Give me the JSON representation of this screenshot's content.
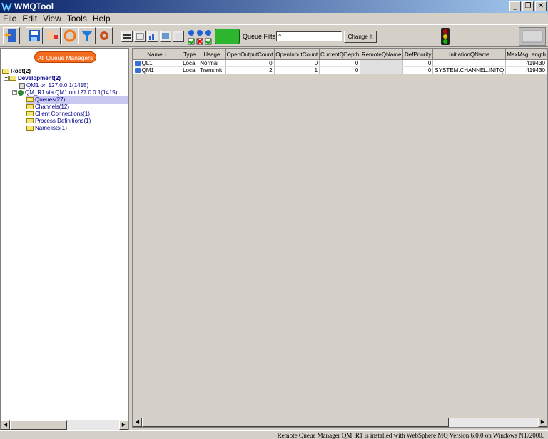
{
  "window": {
    "title": "WMQTool",
    "minimize": "_",
    "restore": "❐",
    "close": "✕"
  },
  "menu": [
    "File",
    "Edit",
    "View",
    "Tools",
    "Help"
  ],
  "toolbar": {
    "filter_label": "Queue Filter:",
    "filter_value": "*",
    "change_button": "Change It",
    "colors": {
      "traffic_red": "#cc0000",
      "traffic_yellow": "#e0c000",
      "traffic_green": "#00c000",
      "green_button": "#2db52d"
    }
  },
  "left": {
    "all_qm_button": "All Queue Managers",
    "tree": [
      {
        "label": "Root(2)",
        "bold": true
      },
      {
        "label": "Development(2)",
        "bold": true,
        "expander": "⊟"
      },
      {
        "label": "QM1 on 127.0.0.1(1415)"
      },
      {
        "label": "QM_R1 via QM1 on 127.0.0.1(1415)",
        "expander": "⊟"
      },
      {
        "label": "Queues(27)",
        "selected": true
      },
      {
        "label": "Channels(12)"
      },
      {
        "label": "Client Connections(1)"
      },
      {
        "label": "Process Definitions(1)"
      },
      {
        "label": "Namelists(1)"
      }
    ]
  },
  "table": {
    "columns": [
      "Name",
      "Type",
      "Usage",
      "OpenOutputCount",
      "OpenInputCount",
      "CurrentQDepth",
      "RemoteQName",
      "DefPriority",
      "InitiationQName",
      "MaxMsgLength"
    ],
    "sort_arrow": "↑",
    "rows": [
      [
        "QL1",
        "Local",
        "Normal",
        "0",
        "0",
        "0",
        "",
        "0",
        "",
        "419430"
      ],
      [
        "QM1",
        "Local",
        "Transmit",
        "2",
        "1",
        "0",
        "",
        "0",
        "SYSTEM.CHANNEL.INITQ",
        "419430"
      ]
    ]
  },
  "status": "Remote Queue Manager QM_R1 is installed with WebSphere MQ Version 6.0.0 on Windows NT/2000."
}
